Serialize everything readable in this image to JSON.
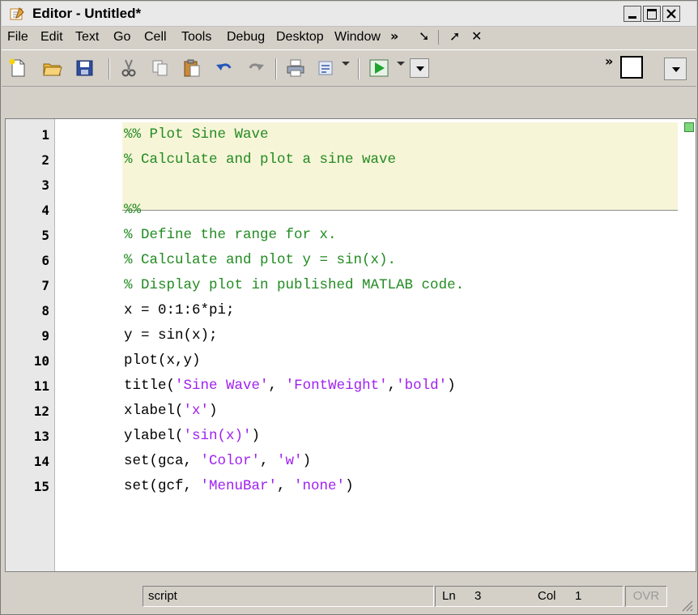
{
  "window": {
    "title": "Editor - Untitled*"
  },
  "menubar": {
    "items": [
      "File",
      "Edit",
      "Text",
      "Go",
      "Cell",
      "Tools",
      "Debug",
      "Desktop",
      "Window"
    ],
    "chevron": "»",
    "dock": "➘",
    "undock": "➚",
    "close": "✕"
  },
  "toolbar": {
    "chevron": "»",
    "icons": [
      "new-file-icon",
      "open-folder-icon",
      "save-icon",
      "cut-icon",
      "copy-icon",
      "paste-icon",
      "undo-icon",
      "redo-icon",
      "print-icon",
      "find-icon",
      "run-icon"
    ]
  },
  "editor": {
    "lines": [
      {
        "n": "1",
        "parts": [
          {
            "t": "%% Plot Sine Wave",
            "c": "comment"
          }
        ]
      },
      {
        "n": "2",
        "parts": [
          {
            "t": "% Calculate and plot a sine wave",
            "c": "comment"
          }
        ]
      },
      {
        "n": "3",
        "parts": []
      },
      {
        "n": "4",
        "parts": [
          {
            "t": "%%",
            "c": "comment"
          }
        ]
      },
      {
        "n": "5",
        "parts": [
          {
            "t": "% Define the range for x.",
            "c": "comment"
          }
        ]
      },
      {
        "n": "6",
        "parts": [
          {
            "t": "% Calculate and plot y = sin(x).",
            "c": "comment"
          }
        ]
      },
      {
        "n": "7",
        "parts": [
          {
            "t": "% Display plot in published MATLAB code.",
            "c": "comment"
          }
        ]
      },
      {
        "n": "8",
        "parts": [
          {
            "t": "x = 0:1:6*pi;",
            "c": "code"
          }
        ]
      },
      {
        "n": "9",
        "parts": [
          {
            "t": "y = sin(x);",
            "c": "code"
          }
        ]
      },
      {
        "n": "10",
        "parts": [
          {
            "t": "plot(x,y)",
            "c": "code"
          }
        ]
      },
      {
        "n": "11",
        "parts": [
          {
            "t": "title(",
            "c": "code"
          },
          {
            "t": "'Sine Wave'",
            "c": "string"
          },
          {
            "t": ", ",
            "c": "code"
          },
          {
            "t": "'FontWeight'",
            "c": "string"
          },
          {
            "t": ",",
            "c": "code"
          },
          {
            "t": "'bold'",
            "c": "string"
          },
          {
            "t": ")",
            "c": "code"
          }
        ]
      },
      {
        "n": "12",
        "parts": [
          {
            "t": "xlabel(",
            "c": "code"
          },
          {
            "t": "'x'",
            "c": "string"
          },
          {
            "t": ")",
            "c": "code"
          }
        ]
      },
      {
        "n": "13",
        "parts": [
          {
            "t": "ylabel(",
            "c": "code"
          },
          {
            "t": "'sin(x)'",
            "c": "string"
          },
          {
            "t": ")",
            "c": "code"
          }
        ]
      },
      {
        "n": "14",
        "parts": [
          {
            "t": "set(gca, ",
            "c": "code"
          },
          {
            "t": "'Color'",
            "c": "string"
          },
          {
            "t": ", ",
            "c": "code"
          },
          {
            "t": "'w'",
            "c": "string"
          },
          {
            "t": ")",
            "c": "code"
          }
        ]
      },
      {
        "n": "15",
        "parts": [
          {
            "t": "set(gcf, ",
            "c": "code"
          },
          {
            "t": "'MenuBar'",
            "c": "string"
          },
          {
            "t": ", ",
            "c": "code"
          },
          {
            "t": "'none'",
            "c": "string"
          },
          {
            "t": ")",
            "c": "code"
          }
        ]
      }
    ]
  },
  "statusbar": {
    "mode": "script",
    "ln_label": "Ln",
    "ln_value": "3",
    "col_label": "Col",
    "col_value": "1",
    "ovr": "OVR"
  },
  "colors": {
    "comment": "#228b22",
    "string": "#a020f0",
    "cell_highlight": "#f7f5d8"
  }
}
